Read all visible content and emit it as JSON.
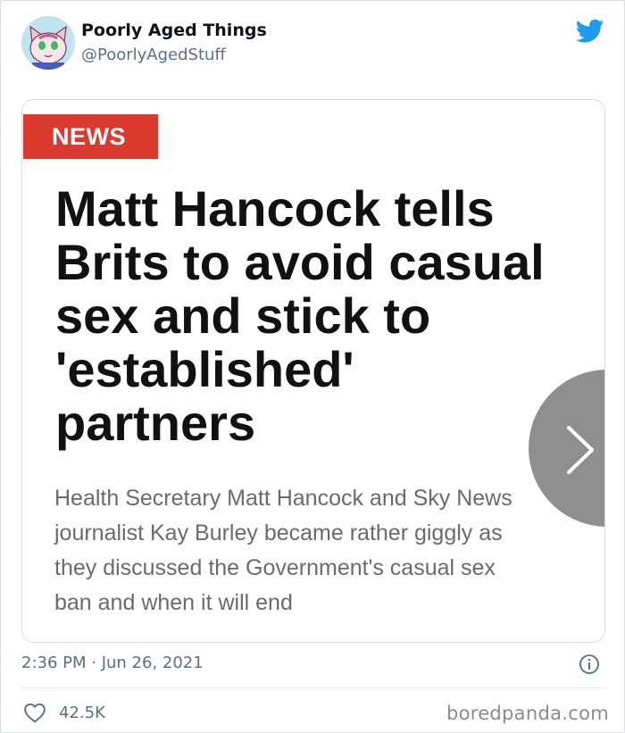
{
  "author": {
    "display_name": "Poorly Aged Things",
    "handle": "@PoorlyAgedStuff"
  },
  "card": {
    "badge": "NEWS",
    "headline_lines": [
      "Matt Hancock tells",
      "Brits to avoid casual",
      "sex and stick to",
      "'established'",
      "partners"
    ],
    "subtext_lines": [
      "Health Secretary Matt Hancock and Sky News",
      "journalist Kay Burley became rather giggly as",
      "they discussed the Government's casual sex",
      "ban and when it will end"
    ],
    "next_icon": "chevron-right-icon"
  },
  "meta": {
    "timestamp": "2:36 PM · Jun 26, 2021",
    "info_icon": "info-icon"
  },
  "engagement": {
    "likes": "42.5K",
    "like_icon": "heart-icon"
  },
  "watermark": "boredpanda.com",
  "colors": {
    "twitter_blue": "#1d9bf0",
    "news_red": "#db3b2f",
    "secondary_text": "#5b7083"
  }
}
